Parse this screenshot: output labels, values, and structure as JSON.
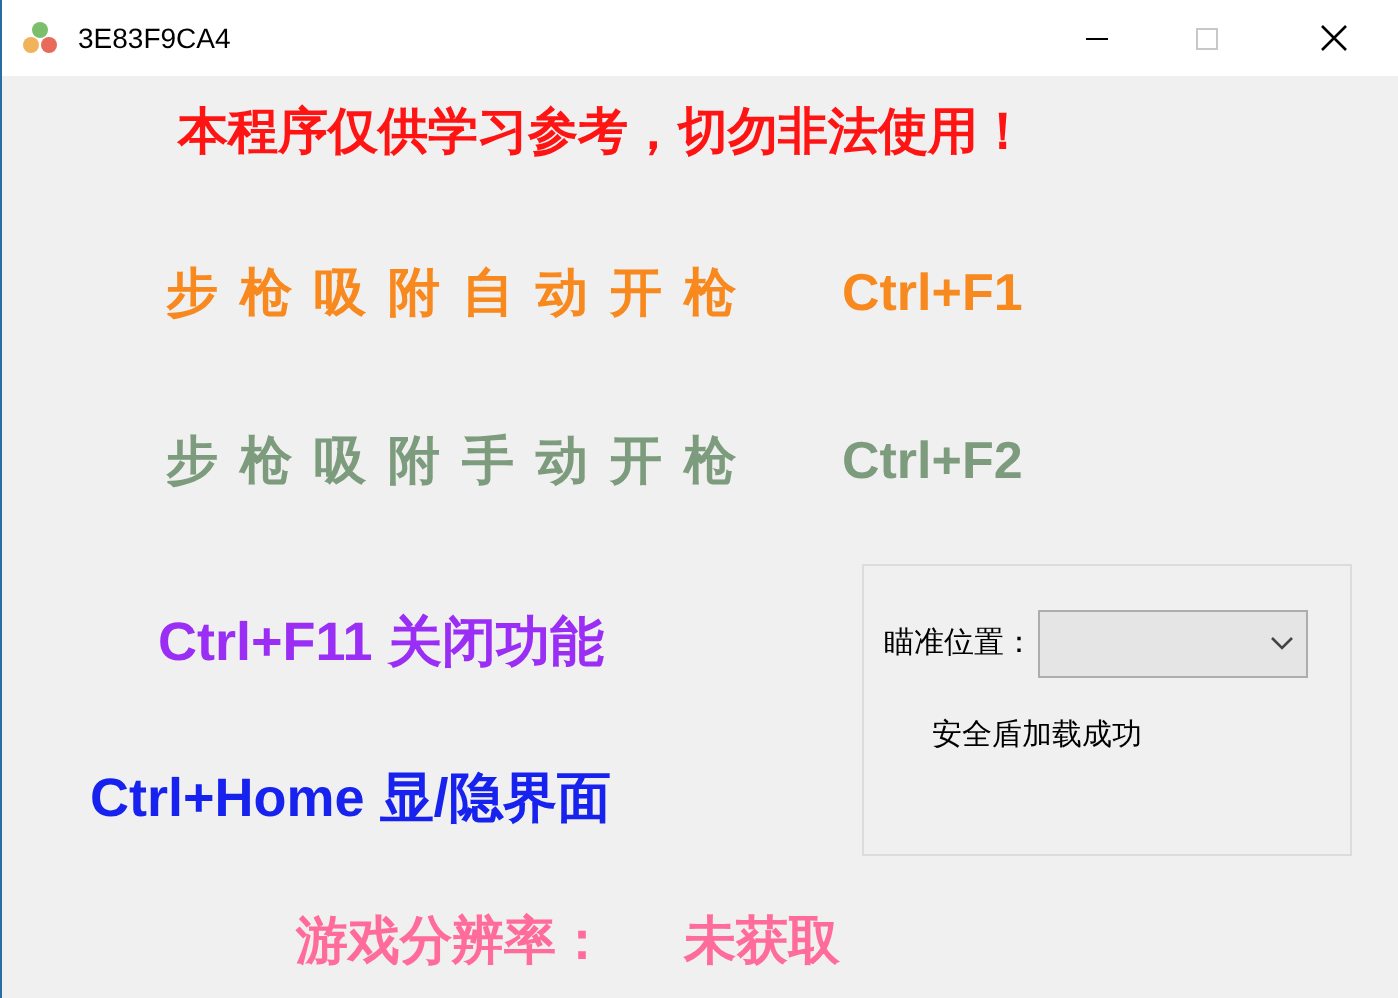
{
  "window": {
    "title": "3E83F9CA4"
  },
  "notice": "本程序仅供学习参考，切勿非法使用！",
  "hotkeys": [
    {
      "label": "步枪吸附自动开枪",
      "key": "Ctrl+F1",
      "color": "#f7891f"
    },
    {
      "label": "步枪吸附手动开枪",
      "key": "Ctrl+F2",
      "color": "#7d9b7d"
    }
  ],
  "shortcuts": [
    {
      "text": "Ctrl+F11 关闭功能",
      "color": "#9a2ef5"
    },
    {
      "text": "Ctrl+Home 显/隐界面",
      "color": "#1722ee"
    }
  ],
  "settings": {
    "aim_label": "瞄准位置：",
    "status": "安全盾加载成功"
  },
  "resolution": {
    "label": "游戏分辨率：",
    "value": "未获取"
  }
}
